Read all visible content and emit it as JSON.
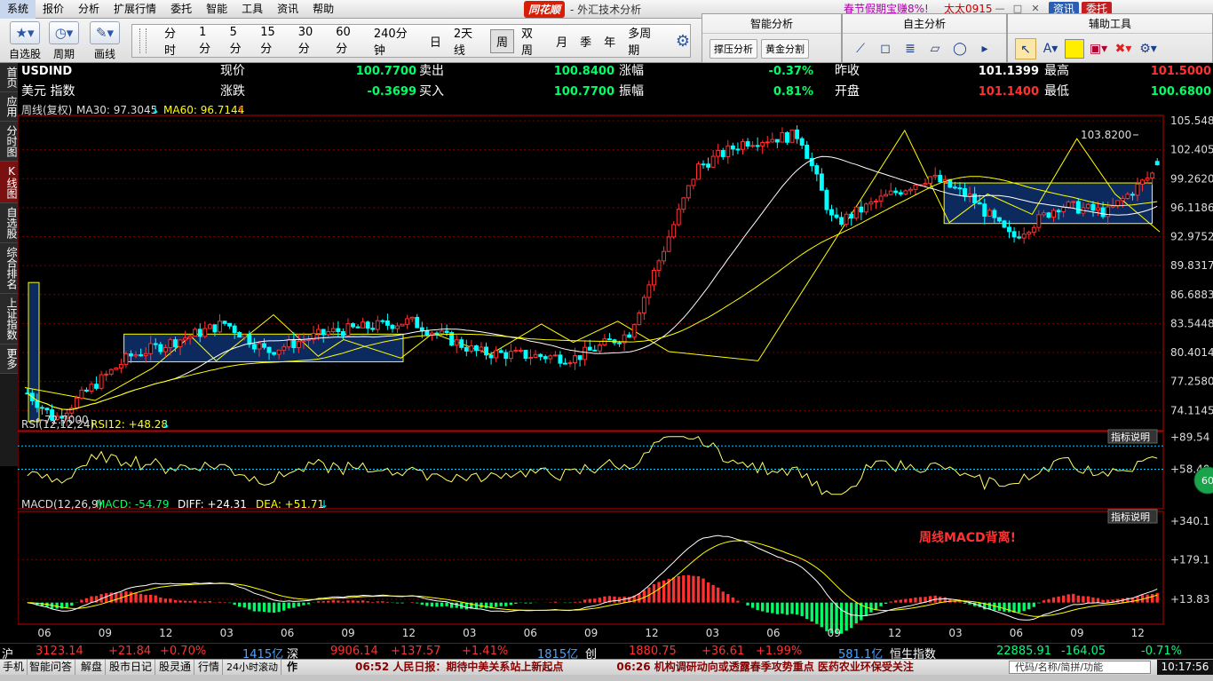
{
  "menu": {
    "items": [
      "系统",
      "报价",
      "分析",
      "扩展行情",
      "委托",
      "智能",
      "工具",
      "资讯",
      "帮助"
    ],
    "brand": "同花顺",
    "subtitle": "- 外汇技术分析",
    "promo": "春节假期宝赚8%!",
    "user": "太太0915",
    "zixun": "资讯",
    "weituo": "委托",
    "win_min": "—",
    "win_max": "□",
    "win_close": "✕"
  },
  "toolbar": {
    "big_tools": [
      {
        "label": "自选股",
        "icon": "star-icon"
      },
      {
        "label": "周期",
        "icon": "clock-icon"
      },
      {
        "label": "画线",
        "icon": "pen-icon"
      }
    ],
    "periods": [
      "分时",
      "1分",
      "5分",
      "15分",
      "30分",
      "60分",
      "240分钟",
      "日",
      "2天线",
      "周",
      "双周",
      "月",
      "季",
      "年",
      "多周期"
    ],
    "active_period": "周",
    "zhineng_title": "智能分析",
    "zhineng_buttons": [
      "撑压分析",
      "黄金分割"
    ],
    "zizhu_title": "自主分析",
    "fuzhu_title": "辅助工具"
  },
  "sidebar": {
    "items": [
      "首页",
      "应用",
      "分时图",
      "K线图",
      "自选股",
      "综合排名",
      "上证指数",
      "更多"
    ],
    "active": "K线图"
  },
  "quote": {
    "code": "USDIND",
    "name": "美元 指数",
    "labels": [
      "现价",
      "卖出",
      "涨幅",
      "昨收",
      "最高",
      "涨跌",
      "买入",
      "振幅",
      "开盘",
      "最低"
    ],
    "price": "100.7700",
    "ask": "100.8400",
    "change_pct": "-0.37%",
    "prev_close": "101.1399",
    "high": "101.5000",
    "change": "-0.3699",
    "bid": "100.7700",
    "amplitude": "0.81%",
    "open": "101.1400",
    "low": "100.6800"
  },
  "main_legend": {
    "period": "周线(复权)",
    "ma30": "MA30: 97.3045",
    "ma30_arrow": "↓",
    "ma60": "MA60: 96.7144",
    "ma60_arrow": "↑"
  },
  "rsi_legend": {
    "label": "RSI(12,12,24)",
    "value": "RSI12: +48.28",
    "arrow": "↓"
  },
  "macd_legend": {
    "label": "MACD(12,26,9)",
    "macd": "MACD: -54.79",
    "diff": "DIFF: +24.31",
    "dea": "DEA: +51.71",
    "arrow": "↓"
  },
  "indicator_button": "指标说明",
  "annotation": "周线MACD背离!",
  "rsi_badge": "60",
  "chart_data": {
    "type": "candlestick",
    "period": "weekly",
    "y_axis_ticks": [
      "105.5489",
      "102.4055",
      "99.2620",
      "96.1186",
      "92.9752",
      "89.8317",
      "86.6883",
      "83.5448",
      "80.4014",
      "77.2580",
      "74.1145"
    ],
    "y_range": [
      72.7,
      105.5489
    ],
    "x_axis_labels": [
      "06",
      "09",
      "12",
      "03",
      "06",
      "09",
      "12",
      "03",
      "06",
      "09",
      "12",
      "03",
      "06",
      "09",
      "12",
      "03",
      "06",
      "09",
      "12"
    ],
    "high_label": "103.8200",
    "low_label": "72.7000",
    "rsi_ticks": [
      "+89.54",
      "+58.40"
    ],
    "macd_ticks": [
      "+340.1",
      "+179.1",
      "+13.83"
    ],
    "boxes": [
      {
        "x": [
          0.262,
          1.0
        ],
        "y": [
          79.4,
          82.4
        ]
      },
      {
        "x": [
          2.43,
          2.98
        ],
        "y": [
          94.4,
          98.8
        ]
      }
    ],
    "series": [
      {
        "name": "MA30",
        "values": []
      },
      {
        "name": "MA60",
        "values": []
      }
    ]
  },
  "status": {
    "sh_label": "沪",
    "sh_value": "3123.14",
    "sh_change": "+21.84",
    "sh_pct": "+0.70%",
    "sh_volume": "1415亿",
    "sz_label": "深",
    "sz_value": "9906.14",
    "sz_change": "+137.57",
    "sz_pct": "+1.41%",
    "sz_volume": "1815亿",
    "cy_label": "创",
    "cy_value": "1880.75",
    "cy_change": "+36.61",
    "cy_pct": "+1.99%",
    "cy_volume": "581.1亿",
    "hs_label": "恒生指数",
    "hs_value": "22885.91",
    "hs_change": "-164.05",
    "hs_pct": "-0.71%",
    "bottom_buttons": [
      "手机",
      "智能问答",
      "解盘",
      "股市日记",
      "股灵通",
      "行情",
      "24小时滚动",
      "作"
    ],
    "news": "06:52 人民日报：期待中美关系站上新起点　　　　　06:26 机构调研动向或透露春季攻势重点 医药农业环保受关注",
    "search_placeholder": "代码/名称/简拼/功能",
    "clock": "10:17:56"
  },
  "colors": {
    "up": "#ff3232",
    "down": "#00ffff",
    "ma30": "#ffffff",
    "ma60": "#ffff00",
    "grid": "#7a0000",
    "axis": "#c00000",
    "box_fill": "#0d2a5e",
    "box_stroke": "#ffff00"
  }
}
